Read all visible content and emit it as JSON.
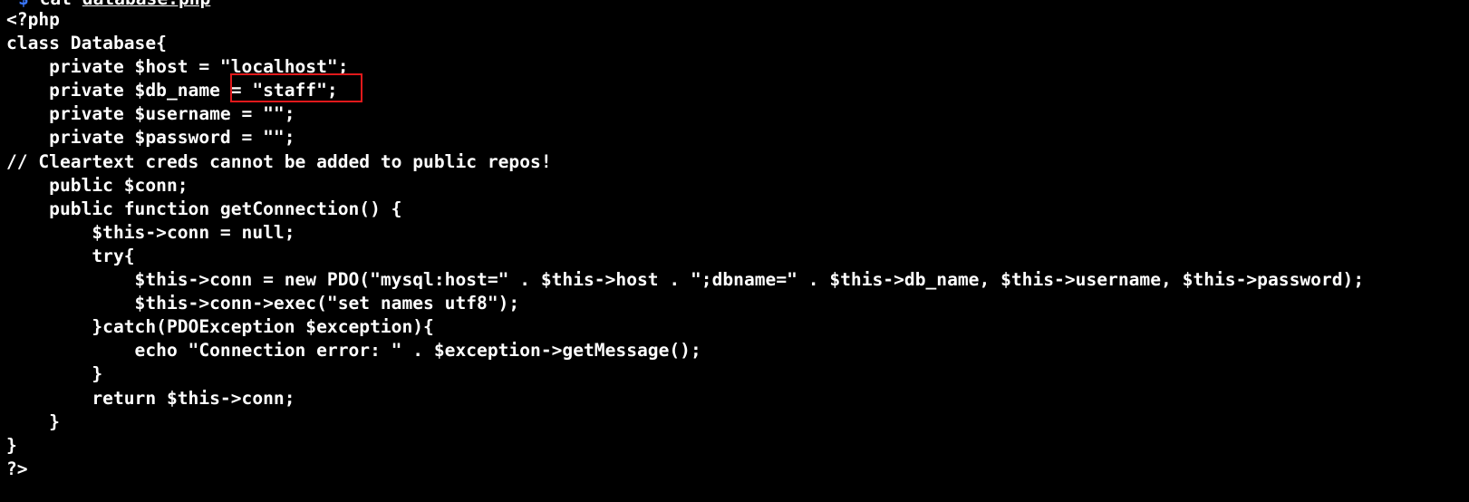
{
  "prompt": {
    "symbol": "$",
    "command": "cat",
    "argument": "database.php"
  },
  "code_lines": [
    "<?php",
    "class Database{",
    "    private $host = \"localhost\";",
    "    private $db_name = \"staff\";",
    "    private $username = \"\";",
    "    private $password = \"\";",
    "// Cleartext creds cannot be added to public repos!",
    "    public $conn;",
    "    public function getConnection() {",
    "        $this->conn = null;",
    "        try{",
    "            $this->conn = new PDO(\"mysql:host=\" . $this->host . \";dbname=\" . $this->db_name, $this->username, $this->password);",
    "            $this->conn->exec(\"set names utf8\");",
    "        }catch(PDOException $exception){",
    "            echo \"Connection error: \" . $exception->getMessage();",
    "        }",
    "        return $this->conn;",
    "    }",
    "}",
    "?>"
  ],
  "colors": {
    "background": "#000000",
    "text": "#ffffff",
    "prompt_symbol": "#3b78ff",
    "highlight_border": "#e0191b"
  }
}
